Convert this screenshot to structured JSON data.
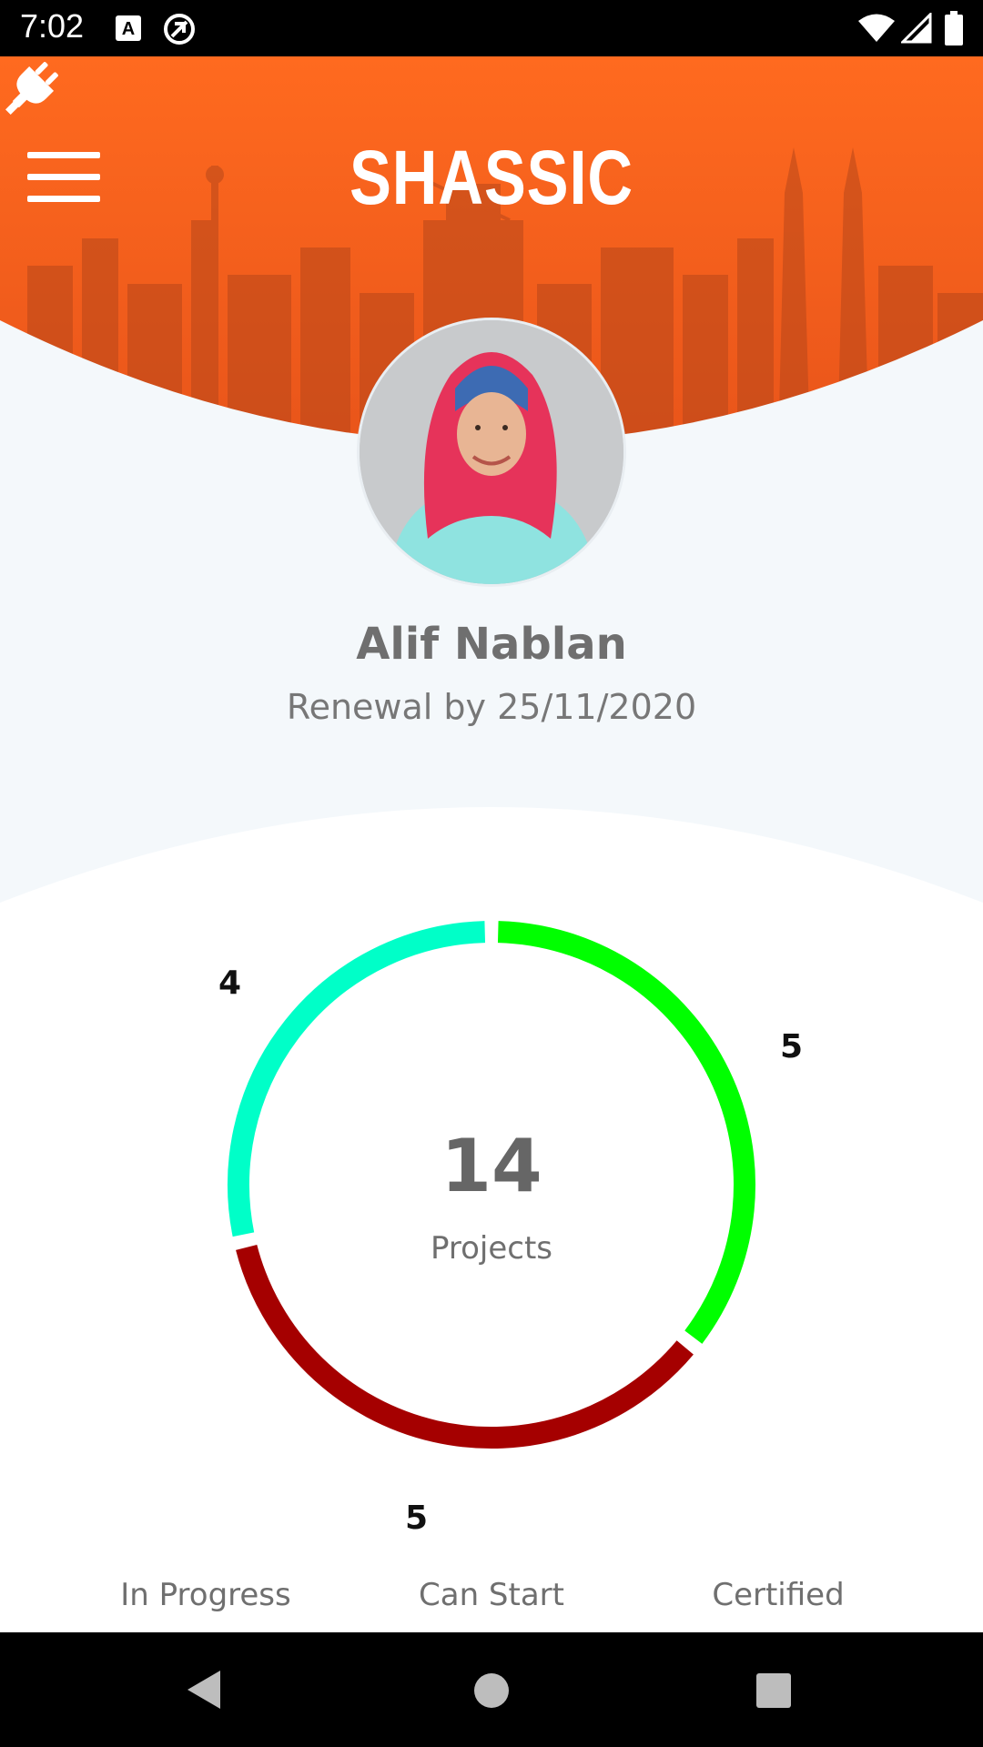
{
  "status_bar": {
    "time": "7:02",
    "icons": [
      "a-keyboard-icon",
      "data-saver-icon",
      "wifi-icon",
      "cell-signal-icon",
      "battery-icon"
    ]
  },
  "header": {
    "title": "SHASSIC",
    "menu_icon": "hamburger-menu-icon",
    "action_icon": "plug-icon",
    "brand_color": "#ff6a1f"
  },
  "profile": {
    "name": "Alif Nablan",
    "renewal": "Renewal by 25/11/2020"
  },
  "chart_data": {
    "type": "pie",
    "donut": true,
    "total": 14,
    "center_label": "Projects",
    "series": [
      {
        "name": "In Progress",
        "value": 4,
        "color": "#00ffc8"
      },
      {
        "name": "Can Start",
        "value": 5,
        "color": "#00ff00"
      },
      {
        "name": "Certified",
        "value": 5,
        "color": "#a50000"
      }
    ]
  },
  "nav_bar": {
    "icons": [
      "back-icon",
      "home-icon",
      "recents-icon"
    ]
  }
}
